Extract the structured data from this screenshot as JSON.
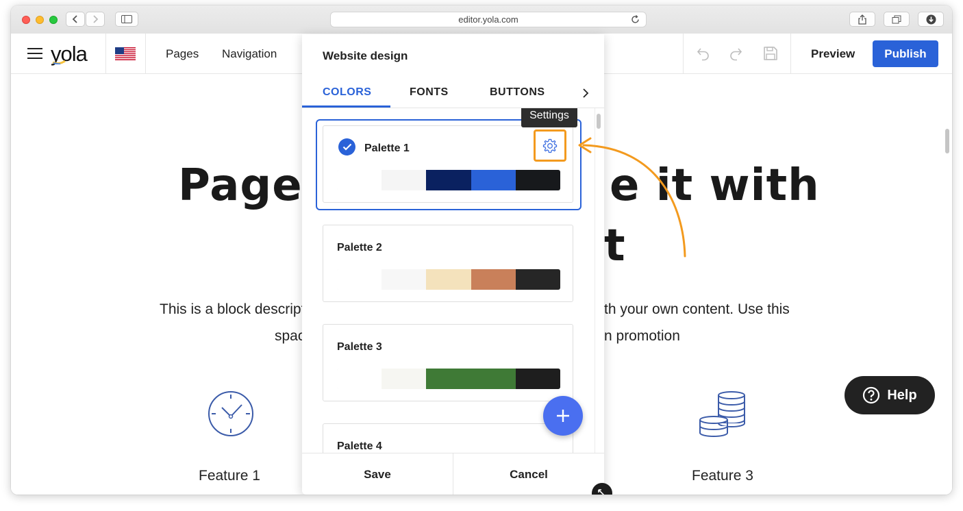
{
  "browser": {
    "url": "editor.yola.com"
  },
  "header": {
    "logo": "yola",
    "nav": {
      "pages": "Pages",
      "navigation": "Navigation"
    },
    "preview_label": "Preview",
    "publish_label": "Publish"
  },
  "page": {
    "hero_left": "Page",
    "hero_right_line1": "e it with",
    "hero_right_line2": "t",
    "desc_line1_left": "This is a block descript",
    "desc_line1_right": "th your own content. Use this",
    "desc_line2_left": "spac",
    "desc_line2_right": "n promotion",
    "features": {
      "feature1": "Feature 1",
      "feature3": "Feature 3"
    }
  },
  "panel": {
    "title": "Website design",
    "tabs": [
      "COLORS",
      "FONTS",
      "BUTTONS"
    ],
    "active_tab": "COLORS",
    "tooltip": "Settings",
    "palettes": [
      {
        "name": "Palette 1",
        "selected": true,
        "colors": [
          "#ffffff",
          "#f5f5f5",
          "#0a2160",
          "#2a62d8",
          "#17191c"
        ]
      },
      {
        "name": "Palette 2",
        "selected": false,
        "colors": [
          "#ffffff",
          "#f7f7f7",
          "#f4e2bc",
          "#c9805a",
          "#262626"
        ]
      },
      {
        "name": "Palette 3",
        "selected": false,
        "colors": [
          "#ffffff",
          "#f6f6f2",
          "#3f7a36",
          "#3f7a36",
          "#1e1e1e"
        ]
      },
      {
        "name": "Palette 4",
        "selected": false
      }
    ],
    "save_label": "Save",
    "cancel_label": "Cancel"
  },
  "help_label": "Help",
  "colors": {
    "accent": "#2a62d8",
    "annotation": "#f39a1e",
    "fab": "#4a6ff0"
  }
}
